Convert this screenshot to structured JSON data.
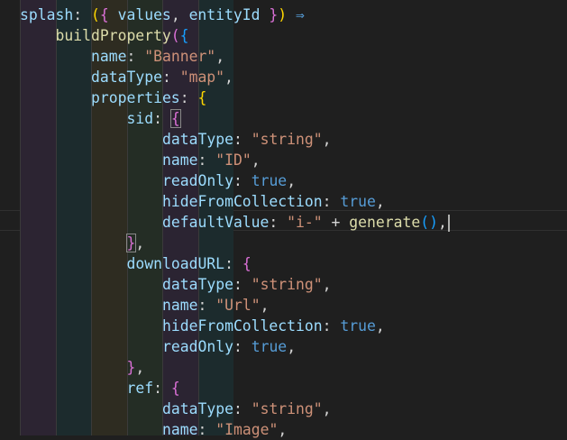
{
  "colors": {
    "background": "#1f1f1f",
    "property": "#9cdcfe",
    "function": "#dcdcaa",
    "string": "#ce9178",
    "keyword": "#569cd6",
    "bracket_level1": "#ffd700",
    "bracket_level2": "#da70d6",
    "bracket_level3": "#179fff",
    "guide_colors": [
      "#2c2432",
      "#1c2b2d",
      "#2e2c21",
      "#242d25",
      "#2b2432",
      "#1c2b2d"
    ]
  },
  "editor": {
    "lines": [
      {
        "indent": 0,
        "tokens": [
          {
            "t": "prop",
            "v": "splash"
          },
          {
            "t": "punct",
            "v": ": "
          },
          {
            "t": "b1",
            "v": "("
          },
          {
            "t": "b2",
            "v": "{"
          },
          {
            "t": "punct",
            "v": " "
          },
          {
            "t": "prop",
            "v": "values"
          },
          {
            "t": "punct",
            "v": ", "
          },
          {
            "t": "prop",
            "v": "entityId"
          },
          {
            "t": "punct",
            "v": " "
          },
          {
            "t": "b2",
            "v": "}"
          },
          {
            "t": "b1",
            "v": ")"
          },
          {
            "t": "kw",
            "v": " ⇒"
          }
        ]
      },
      {
        "indent": 1,
        "tokens": [
          {
            "t": "func",
            "v": "buildProperty"
          },
          {
            "t": "b2",
            "v": "("
          },
          {
            "t": "b3",
            "v": "{"
          }
        ]
      },
      {
        "indent": 2,
        "tokens": [
          {
            "t": "prop",
            "v": "name"
          },
          {
            "t": "punct",
            "v": ": "
          },
          {
            "t": "str",
            "v": "\"Banner\""
          },
          {
            "t": "punct",
            "v": ","
          }
        ]
      },
      {
        "indent": 2,
        "tokens": [
          {
            "t": "prop",
            "v": "dataType"
          },
          {
            "t": "punct",
            "v": ": "
          },
          {
            "t": "str",
            "v": "\"map\""
          },
          {
            "t": "punct",
            "v": ","
          }
        ]
      },
      {
        "indent": 2,
        "tokens": [
          {
            "t": "prop",
            "v": "properties"
          },
          {
            "t": "punct",
            "v": ": "
          },
          {
            "t": "b1",
            "v": "{"
          }
        ]
      },
      {
        "indent": 3,
        "tokens": [
          {
            "t": "prop",
            "v": "sid"
          },
          {
            "t": "punct",
            "v": ": "
          },
          {
            "t": "b2m",
            "v": "{"
          }
        ]
      },
      {
        "indent": 4,
        "tokens": [
          {
            "t": "prop",
            "v": "dataType"
          },
          {
            "t": "punct",
            "v": ": "
          },
          {
            "t": "str",
            "v": "\"string\""
          },
          {
            "t": "punct",
            "v": ","
          }
        ]
      },
      {
        "indent": 4,
        "tokens": [
          {
            "t": "prop",
            "v": "name"
          },
          {
            "t": "punct",
            "v": ": "
          },
          {
            "t": "str",
            "v": "\"ID\""
          },
          {
            "t": "punct",
            "v": ","
          }
        ]
      },
      {
        "indent": 4,
        "tokens": [
          {
            "t": "prop",
            "v": "readOnly"
          },
          {
            "t": "punct",
            "v": ": "
          },
          {
            "t": "kw",
            "v": "true"
          },
          {
            "t": "punct",
            "v": ","
          }
        ]
      },
      {
        "indent": 4,
        "tokens": [
          {
            "t": "prop",
            "v": "hideFromCollection"
          },
          {
            "t": "punct",
            "v": ": "
          },
          {
            "t": "kw",
            "v": "true"
          },
          {
            "t": "punct",
            "v": ","
          }
        ]
      },
      {
        "indent": 4,
        "tokens": [
          {
            "t": "prop",
            "v": "defaultValue"
          },
          {
            "t": "punct",
            "v": ": "
          },
          {
            "t": "str",
            "v": "\"i-\""
          },
          {
            "t": "punct",
            "v": " + "
          },
          {
            "t": "func",
            "v": "generate"
          },
          {
            "t": "b3",
            "v": "()"
          },
          {
            "t": "punct",
            "v": ","
          }
        ],
        "cursor": true
      },
      {
        "indent": 3,
        "tokens": [
          {
            "t": "b2m",
            "v": "}"
          },
          {
            "t": "punct",
            "v": ","
          }
        ]
      },
      {
        "indent": 3,
        "tokens": [
          {
            "t": "prop",
            "v": "downloadURL"
          },
          {
            "t": "punct",
            "v": ": "
          },
          {
            "t": "b2",
            "v": "{"
          }
        ]
      },
      {
        "indent": 4,
        "tokens": [
          {
            "t": "prop",
            "v": "dataType"
          },
          {
            "t": "punct",
            "v": ": "
          },
          {
            "t": "str",
            "v": "\"string\""
          },
          {
            "t": "punct",
            "v": ","
          }
        ]
      },
      {
        "indent": 4,
        "tokens": [
          {
            "t": "prop",
            "v": "name"
          },
          {
            "t": "punct",
            "v": ": "
          },
          {
            "t": "str",
            "v": "\"Url\""
          },
          {
            "t": "punct",
            "v": ","
          }
        ]
      },
      {
        "indent": 4,
        "tokens": [
          {
            "t": "prop",
            "v": "hideFromCollection"
          },
          {
            "t": "punct",
            "v": ": "
          },
          {
            "t": "kw",
            "v": "true"
          },
          {
            "t": "punct",
            "v": ","
          }
        ]
      },
      {
        "indent": 4,
        "tokens": [
          {
            "t": "prop",
            "v": "readOnly"
          },
          {
            "t": "punct",
            "v": ": "
          },
          {
            "t": "kw",
            "v": "true"
          },
          {
            "t": "punct",
            "v": ","
          }
        ]
      },
      {
        "indent": 3,
        "tokens": [
          {
            "t": "b2",
            "v": "}"
          },
          {
            "t": "punct",
            "v": ","
          }
        ]
      },
      {
        "indent": 3,
        "tokens": [
          {
            "t": "prop",
            "v": "ref"
          },
          {
            "t": "punct",
            "v": ": "
          },
          {
            "t": "b2",
            "v": "{"
          }
        ]
      },
      {
        "indent": 4,
        "tokens": [
          {
            "t": "prop",
            "v": "dataType"
          },
          {
            "t": "punct",
            "v": ": "
          },
          {
            "t": "str",
            "v": "\"string\""
          },
          {
            "t": "punct",
            "v": ","
          }
        ]
      },
      {
        "indent": 4,
        "tokens": [
          {
            "t": "prop",
            "v": "name"
          },
          {
            "t": "punct",
            "v": ": "
          },
          {
            "t": "str",
            "v": "\"Image\""
          },
          {
            "t": "punct",
            "v": ","
          }
        ]
      }
    ]
  }
}
